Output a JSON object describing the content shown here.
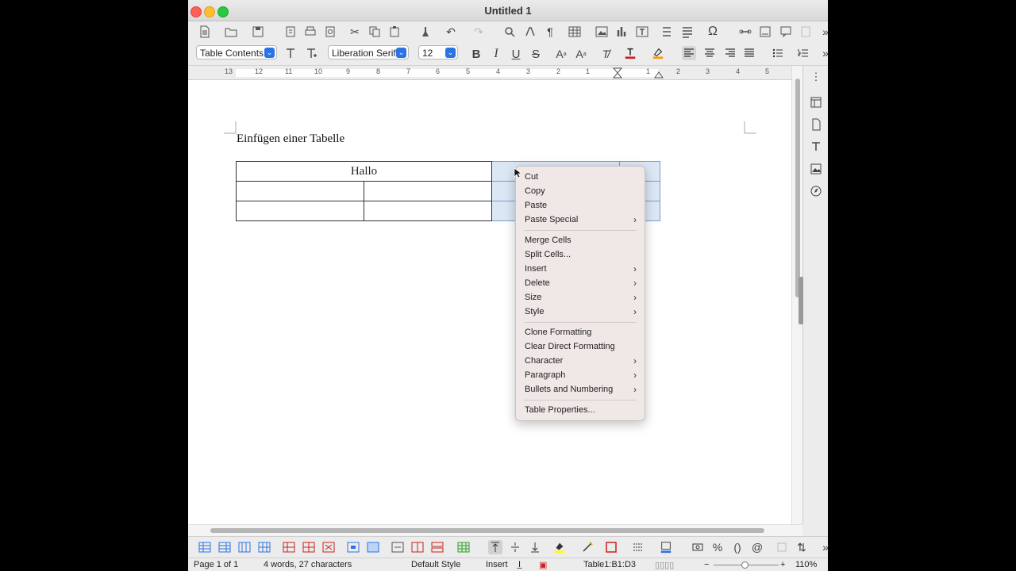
{
  "window": {
    "title": "Untitled 1"
  },
  "formatting": {
    "paragraph_style": "Table Contents",
    "font_name": "Liberation Serif",
    "font_size": "12"
  },
  "ruler": {
    "numbers": [
      "13",
      "12",
      "11",
      "10",
      "9",
      "8",
      "7",
      "6",
      "5",
      "4",
      "3",
      "2",
      "1",
      "1",
      "2",
      "3",
      "4",
      "5"
    ]
  },
  "document": {
    "heading": "Einfügen einer Tabelle",
    "table": {
      "rows": [
        [
          "Hallo",
          "",
          "",
          ""
        ],
        [
          "",
          "",
          "",
          ""
        ],
        [
          "",
          "",
          "",
          ""
        ]
      ]
    }
  },
  "context_menu": {
    "items": [
      {
        "label": "Cut",
        "submenu": false
      },
      {
        "label": "Copy",
        "submenu": false
      },
      {
        "label": "Paste",
        "submenu": false
      },
      {
        "label": "Paste Special",
        "submenu": true
      },
      {
        "label": "Merge Cells",
        "submenu": false
      },
      {
        "label": "Split Cells...",
        "submenu": false
      },
      {
        "label": "Insert",
        "submenu": true
      },
      {
        "label": "Delete",
        "submenu": true
      },
      {
        "label": "Size",
        "submenu": true
      },
      {
        "label": "Style",
        "submenu": true
      },
      {
        "label": "Clone Formatting",
        "submenu": false
      },
      {
        "label": "Clear Direct Formatting",
        "submenu": false
      },
      {
        "label": "Character",
        "submenu": true
      },
      {
        "label": "Paragraph",
        "submenu": true
      },
      {
        "label": "Bullets and Numbering",
        "submenu": true
      },
      {
        "label": "Table Properties...",
        "submenu": false
      }
    ],
    "submenu_glyph": "›"
  },
  "statusbar": {
    "page": "Page 1 of 1",
    "words": "4 words, 27 characters",
    "page_style": "Default Style",
    "insert_mode": "Insert",
    "table_cell": "Table1:B1:D3",
    "zoom": "110%",
    "zoom_minus": "−",
    "zoom_plus": "+"
  },
  "colors": {
    "selection": "#dbe7f5",
    "font_color_bar": "#c9211e",
    "highlight_bar": "#ffff00",
    "accent": "#2b73e3"
  }
}
